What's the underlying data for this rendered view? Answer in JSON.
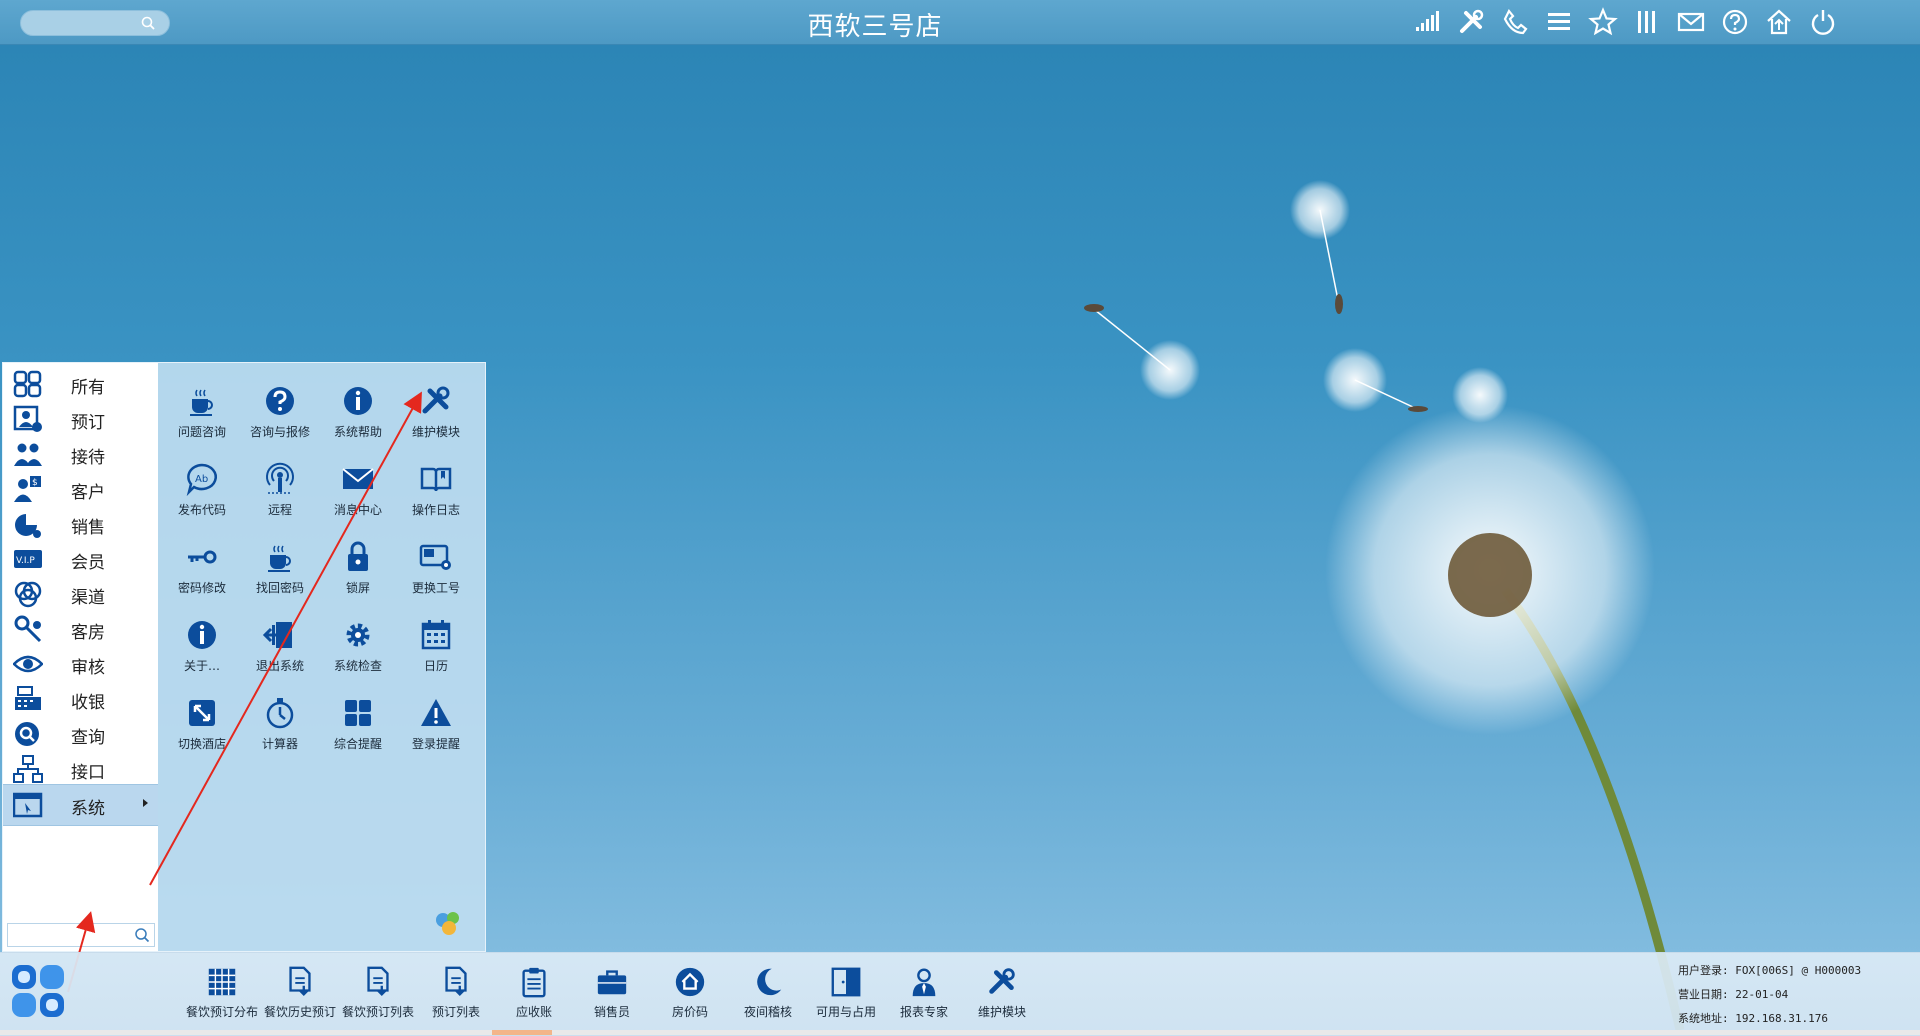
{
  "window": {
    "title": "西软三号店"
  },
  "top_search": {
    "placeholder": ""
  },
  "top_icons": [
    "signal-icon",
    "tools-icon",
    "phone-icon",
    "menu-icon",
    "star-icon",
    "columns-icon",
    "mail-icon",
    "help-icon",
    "home-upload-icon",
    "power-icon"
  ],
  "menu": {
    "categories": [
      {
        "label": "所有",
        "icon": "all-apps-icon"
      },
      {
        "label": "预订",
        "icon": "reservation-icon"
      },
      {
        "label": "接待",
        "icon": "reception-icon"
      },
      {
        "label": "客户",
        "icon": "customer-icon"
      },
      {
        "label": "销售",
        "icon": "sales-icon"
      },
      {
        "label": "会员",
        "icon": "vip-icon"
      },
      {
        "label": "渠道",
        "icon": "channel-icon"
      },
      {
        "label": "客房",
        "icon": "housekeeping-icon"
      },
      {
        "label": "审核",
        "icon": "audit-eye-icon"
      },
      {
        "label": "收银",
        "icon": "cashier-icon"
      },
      {
        "label": "查询",
        "icon": "query-icon"
      },
      {
        "label": "接口",
        "icon": "interface-icon"
      },
      {
        "label": "系统",
        "icon": "system-icon",
        "active": true
      }
    ],
    "search_value": "",
    "apps": [
      {
        "label": "问题咨询",
        "icon": "coffee-icon"
      },
      {
        "label": "咨询与报修",
        "icon": "question-icon"
      },
      {
        "label": "系统帮助",
        "icon": "info-icon"
      },
      {
        "label": "维护模块",
        "icon": "wrench-icon"
      },
      {
        "label": "发布代码",
        "icon": "chat-code-icon"
      },
      {
        "label": "远程",
        "icon": "remote-icon"
      },
      {
        "label": "消息中心",
        "icon": "envelope-icon"
      },
      {
        "label": "操作日志",
        "icon": "book-icon"
      },
      {
        "label": "密码修改",
        "icon": "key-icon"
      },
      {
        "label": "找回密码",
        "icon": "coffee-icon"
      },
      {
        "label": "锁屏",
        "icon": "lock-icon"
      },
      {
        "label": "更换工号",
        "icon": "id-card-icon"
      },
      {
        "label": "关于…",
        "icon": "info-icon"
      },
      {
        "label": "退出系统",
        "icon": "exit-icon"
      },
      {
        "label": "系统检查",
        "icon": "gear-icon"
      },
      {
        "label": "日历",
        "icon": "calendar-icon"
      },
      {
        "label": "切换酒店",
        "icon": "switch-hotel-icon"
      },
      {
        "label": "计算器",
        "icon": "stopwatch-icon"
      },
      {
        "label": "综合提醒",
        "icon": "grid-icon"
      },
      {
        "label": "登录提醒",
        "icon": "warning-icon"
      }
    ]
  },
  "taskbar": {
    "items": [
      {
        "label": "餐饮预订分布",
        "icon": "table-grid-icon"
      },
      {
        "label": "餐饮历史预订",
        "icon": "doc-download-icon"
      },
      {
        "label": "餐饮预订列表",
        "icon": "doc-download-icon"
      },
      {
        "label": "预订列表",
        "icon": "doc-download-icon"
      },
      {
        "label": "应收账",
        "icon": "clipboard-icon"
      },
      {
        "label": "销售员",
        "icon": "briefcase-icon"
      },
      {
        "label": "房价码",
        "icon": "house-icon"
      },
      {
        "label": "夜间稽核",
        "icon": "moon-icon"
      },
      {
        "label": "可用与占用",
        "icon": "door-icon"
      },
      {
        "label": "报表专家",
        "icon": "user-tie-icon"
      },
      {
        "label": "维护模块",
        "icon": "wrench-icon"
      }
    ],
    "status": {
      "login": "用户登录: FOX[006S] @ H000003",
      "business_date": "营业日期: 22-01-04",
      "address": "系统地址: 192.168.31.176"
    }
  },
  "colors": {
    "icon_blue": "#0c4d9c",
    "annotation_red": "#e4281e"
  }
}
